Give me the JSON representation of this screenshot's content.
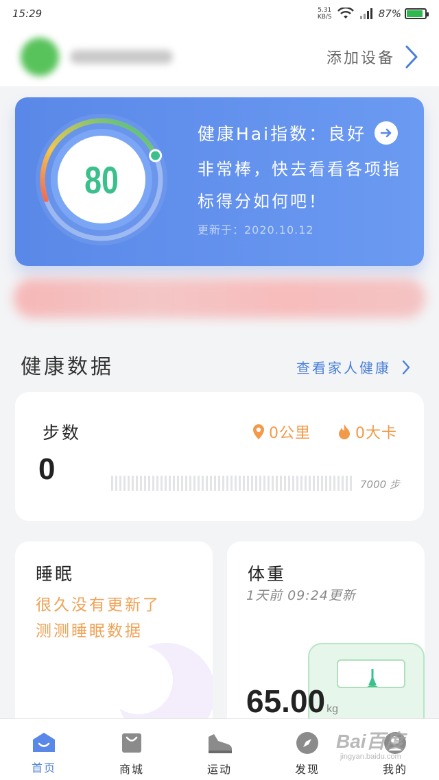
{
  "status_bar": {
    "time": "15:29",
    "net_speed": "5.31",
    "net_unit": "KB/S",
    "battery": "87%",
    "battery_level": 0.87
  },
  "header": {
    "add_device": "添加设备"
  },
  "health_index": {
    "score": "80",
    "score_value": 80,
    "score_max": 100,
    "title": "健康Hai指数：良好",
    "description": "非常棒，快去看看各项指标得分如何吧！",
    "updated": "更新于：2020.10.12"
  },
  "health_data": {
    "title": "健康数据",
    "family_link": "查看家人健康"
  },
  "steps": {
    "label": "步数",
    "value": "0",
    "distance": "0公里",
    "calories": "0大卡",
    "goal": "7000 步",
    "progress": 0
  },
  "sleep": {
    "title": "睡眠",
    "message_line1": "很久没有更新了",
    "message_line2": "测测睡眠数据"
  },
  "weight": {
    "title": "体重",
    "updated": "1天前 09:24更新",
    "value": "65.00",
    "unit": "kg"
  },
  "nav": [
    {
      "label": "首页",
      "active": true
    },
    {
      "label": "商城",
      "active": false
    },
    {
      "label": "运动",
      "active": false
    },
    {
      "label": "发现",
      "active": false
    },
    {
      "label": "我的",
      "active": false
    }
  ],
  "watermark": {
    "main": "Bai百度",
    "sub": "jingyan.baidu.com"
  },
  "colors": {
    "card_blue": "#5f8ff0",
    "score_green": "#3bc08c",
    "accent_orange": "#f0a255",
    "link_blue": "#4a7fd8"
  }
}
